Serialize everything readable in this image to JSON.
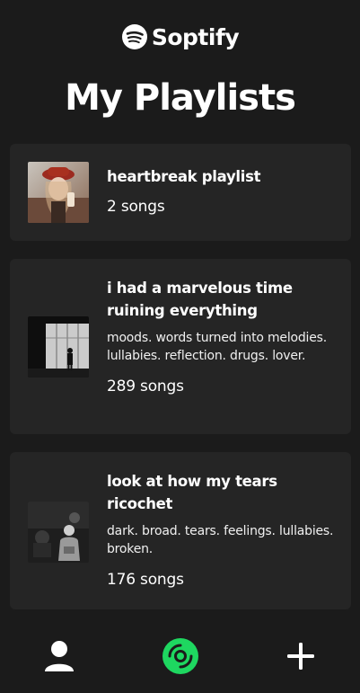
{
  "app": {
    "name": "Soptify"
  },
  "page": {
    "title": "My Playlists"
  },
  "colors": {
    "background": "#1b1b1b",
    "card": "#252525",
    "accent": "#1ed760",
    "text": "#ffffff"
  },
  "playlists": [
    {
      "title": "heartbreak playlist",
      "description": "",
      "count": "2 songs",
      "cover_icon": "red-hat-portrait-cover"
    },
    {
      "title": "i had a marvelous time ruining everything",
      "description": "moods. words turned into melodies. lullabies. reflection. drugs. lover.",
      "count": "289 songs",
      "cover_icon": "silhouette-window-cover"
    },
    {
      "title": "look at how my tears ricochet",
      "description": "dark. broad. tears. feelings. lullabies. broken.",
      "count": "176 songs",
      "cover_icon": "dark-studio-cover"
    }
  ],
  "nav": {
    "profile_icon": "user-icon",
    "playlists_icon": "vinyl-disc-icon",
    "add_icon": "plus-icon"
  }
}
